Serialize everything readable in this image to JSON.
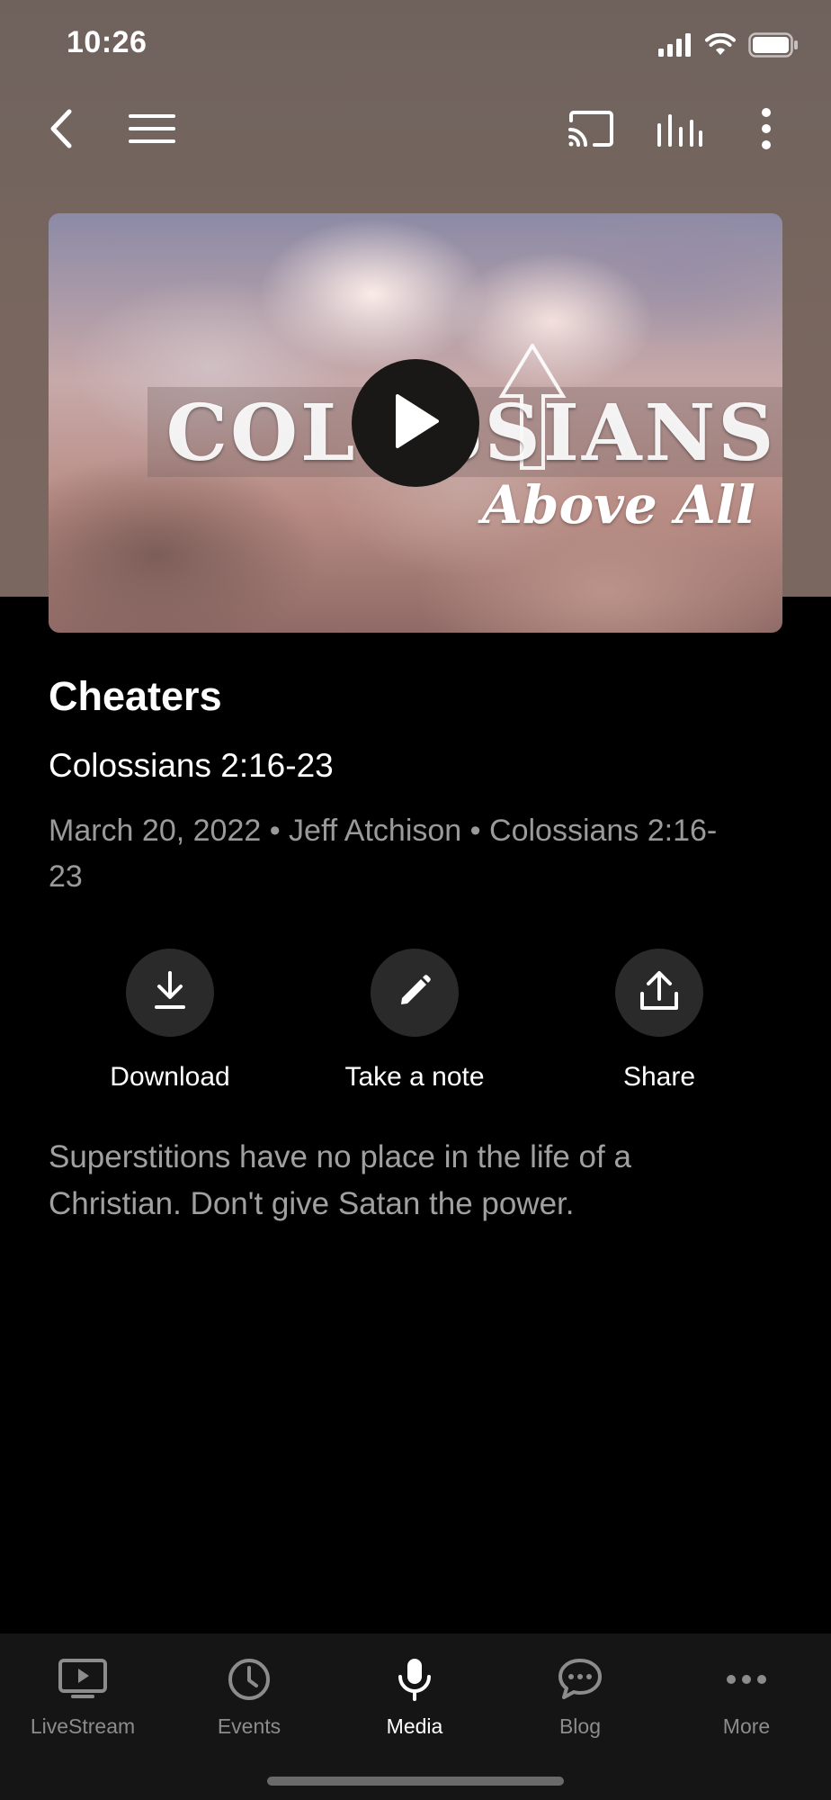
{
  "status_bar": {
    "time": "10:26"
  },
  "artwork": {
    "series_title": "COLOSSIANS",
    "series_subtitle": "Above All"
  },
  "sermon": {
    "title": "Cheaters",
    "scripture": "Colossians 2:16-23",
    "meta": "March 20, 2022 • Jeff Atchison • Colossians 2:16-23",
    "description": "Superstitions have no place in the life of a Christian.  Don't give Satan the power."
  },
  "actions": {
    "download": {
      "label": "Download",
      "icon": "download-icon"
    },
    "note": {
      "label": "Take a note",
      "icon": "pencil-icon"
    },
    "share": {
      "label": "Share",
      "icon": "share-icon"
    }
  },
  "tabs": [
    {
      "label": "LiveStream",
      "icon": "tv-play-icon",
      "active": false
    },
    {
      "label": "Events",
      "icon": "clock-icon",
      "active": false
    },
    {
      "label": "Media",
      "icon": "microphone-icon",
      "active": true
    },
    {
      "label": "Blog",
      "icon": "chat-bubble-icon",
      "active": false
    },
    {
      "label": "More",
      "icon": "ellipsis-icon",
      "active": false
    }
  ],
  "colors": {
    "header_bg": "#79675f",
    "page_bg": "#000000",
    "tab_bar_bg": "#151515",
    "inactive_tab": "#8c8c8c"
  }
}
